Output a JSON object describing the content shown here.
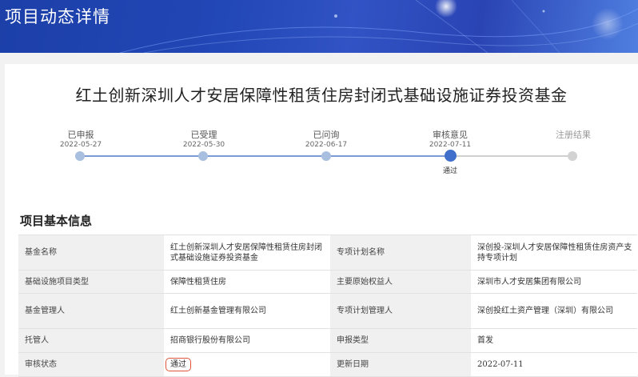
{
  "banner": {
    "title": "项目动态详情"
  },
  "project": {
    "title": "红土创新深圳人才安居保障性租赁住房封闭式基础设施证券投资基金"
  },
  "progress": {
    "steps": [
      {
        "label": "已申报",
        "date": "2022-05-27",
        "status": "",
        "state": "done"
      },
      {
        "label": "已受理",
        "date": "2022-05-30",
        "status": "",
        "state": "done"
      },
      {
        "label": "已问询",
        "date": "2022-06-17",
        "status": "",
        "state": "done"
      },
      {
        "label": "审核意见",
        "date": "2022-07-11",
        "status": "通过",
        "state": "current"
      },
      {
        "label": "注册结果",
        "date": "",
        "status": "",
        "state": "pending"
      }
    ]
  },
  "info": {
    "section_title": "项目基本信息",
    "rows": [
      {
        "k1": "基金名称",
        "v1": "红土创新深圳人才安居保障性租赁住房封闭式基础设施证券投资基金",
        "k2": "专项计划名称",
        "v2": "深创投-深圳人才安居保障性租赁住房资产支持专项计划"
      },
      {
        "k1": "基础设施项目类型",
        "v1": "保障性租赁住房",
        "k2": "主要原始权益人",
        "v2": "深圳市人才安居集团有限公司"
      },
      {
        "k1": "基金管理人",
        "v1": "红土创新基金管理有限公司",
        "k2": "专项计划管理人",
        "v2": "深创投红土资产管理（深圳）有限公司"
      },
      {
        "k1": "托管人",
        "v1": "招商银行股份有限公司",
        "k2": "申报类型",
        "v2": "首发"
      },
      {
        "k1": "审核状态",
        "v1": "通过",
        "k2": "更新日期",
        "v2": "2022-07-11"
      }
    ]
  }
}
